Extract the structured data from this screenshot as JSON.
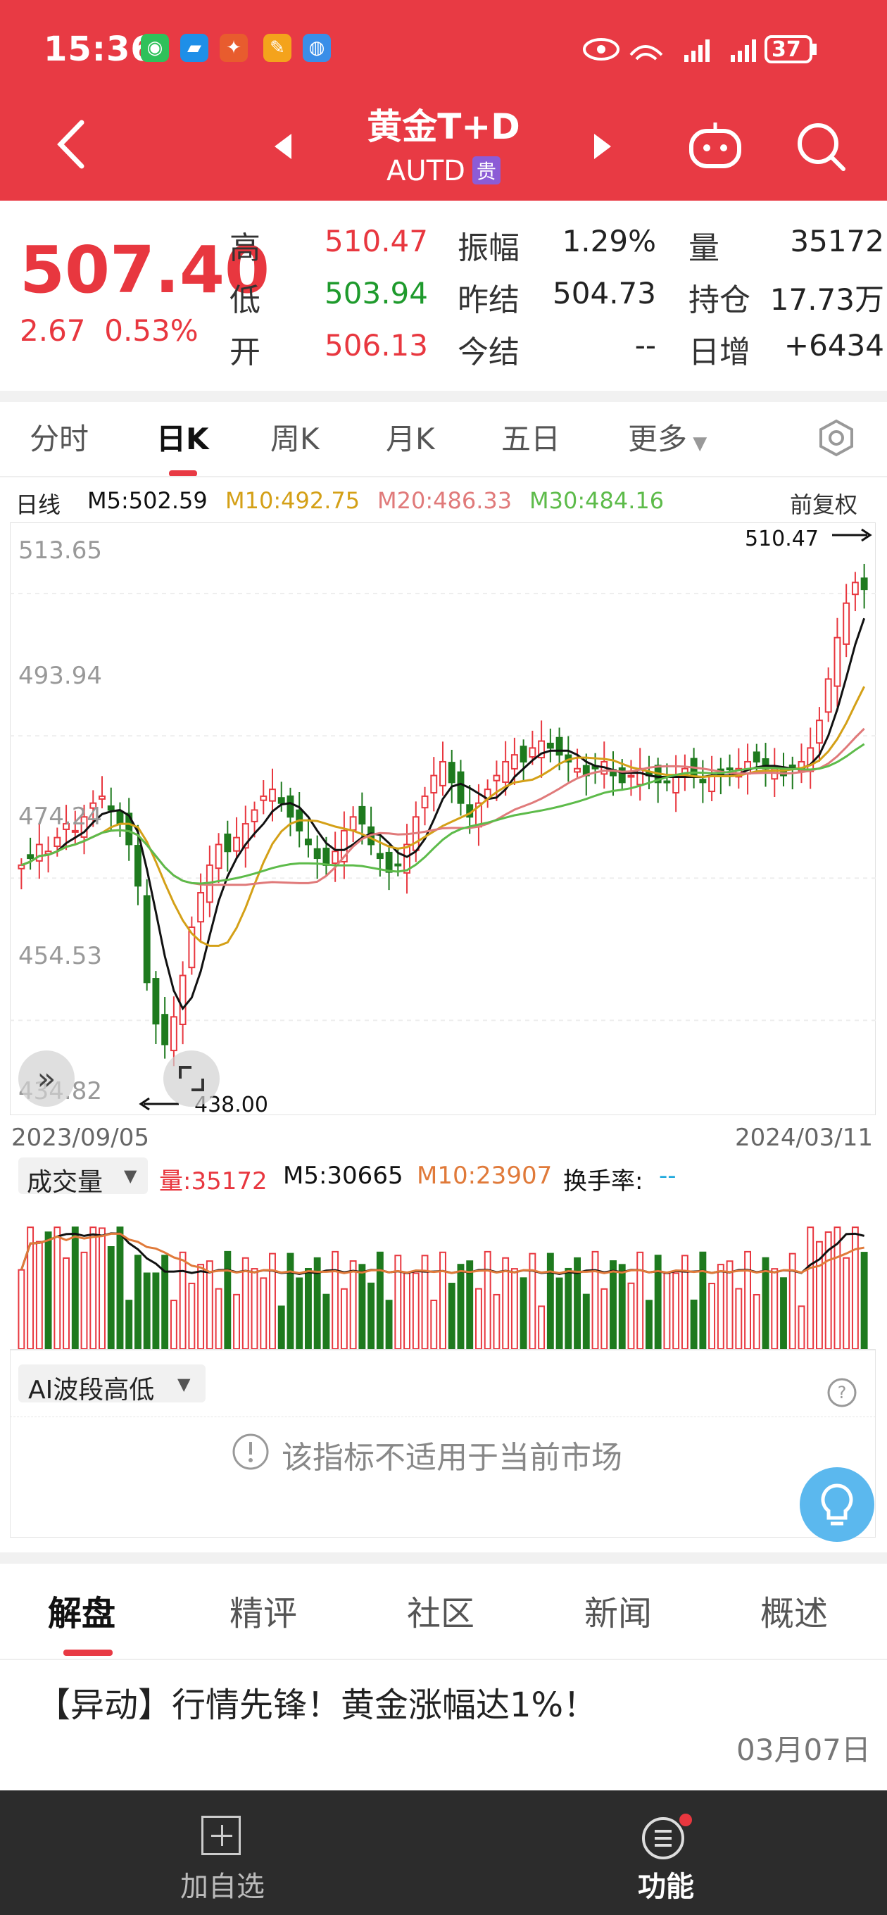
{
  "status": {
    "time": "15:36",
    "battery": "37"
  },
  "header": {
    "title": "黄金T+D",
    "code": "AUTD",
    "badge": "贵"
  },
  "quote": {
    "price": "507.40",
    "change": "2.67",
    "change_pct": "0.53%",
    "rows": [
      {
        "l1": "高",
        "v1": "510.47",
        "l2": "振幅",
        "v2": "1.29%",
        "l3": "量",
        "v3": "35172"
      },
      {
        "l1": "低",
        "v1": "503.94",
        "l2": "昨结",
        "v2": "504.73",
        "l3": "持仓",
        "v3": "17.73万"
      },
      {
        "l1": "开",
        "v1": "506.13",
        "l2": "今结",
        "v2": "--",
        "l3": "日增",
        "v3": "+6434"
      }
    ]
  },
  "tabs": [
    "分时",
    "日K",
    "周K",
    "月K",
    "五日",
    "更多"
  ],
  "ma_legend": {
    "label": "日线",
    "m5": "M5:502.59",
    "m10": "M10:492.75",
    "m20": "M20:486.33",
    "m30": "M30:484.16",
    "adjust": "前复权"
  },
  "chart_data": {
    "type": "candlestick",
    "x_start": "2023/09/05",
    "x_end": "2024/03/11",
    "y_ticks": [
      "513.65",
      "493.94",
      "474.24",
      "454.53",
      "434.82"
    ],
    "ylim": [
      434.82,
      513.65
    ],
    "high_marker": "510.47",
    "low_marker": "438.00",
    "series_colors": {
      "up": "#e8373f",
      "down": "#1e7a1e",
      "m5": "#111111",
      "m10": "#d4a017",
      "m20": "#e07a7a",
      "m30": "#5dbb4a"
    },
    "closes": [
      467,
      468,
      470,
      469,
      471,
      473,
      472,
      474,
      476,
      477,
      475,
      473,
      470,
      464,
      450,
      444,
      441,
      445,
      451,
      458,
      463,
      467,
      470,
      469,
      471,
      473,
      475,
      477,
      478,
      476,
      474,
      472,
      470,
      468,
      467,
      469,
      472,
      474,
      473,
      470,
      468,
      466,
      467,
      470,
      474,
      477,
      480,
      482,
      479,
      476,
      474,
      476,
      478,
      480,
      482,
      483,
      482,
      484,
      485,
      484,
      483,
      482,
      481,
      480,
      481,
      482,
      480,
      479,
      480,
      481,
      480,
      479,
      479,
      480,
      481,
      480,
      479,
      480,
      480,
      481,
      481,
      482,
      482,
      481,
      481,
      480,
      481,
      482,
      484,
      488,
      494,
      500,
      505,
      508,
      507
    ],
    "volume": {
      "label": "成交量",
      "vol": "量:35172",
      "m5": "M5:30665",
      "m10": "M10:23907",
      "turnover": "换手率:",
      "turnover_val": "--"
    }
  },
  "indicator": {
    "name": "AI波段高低",
    "message": "该指标不适用于当前市场"
  },
  "bottom_tabs": [
    "解盘",
    "精评",
    "社区",
    "新闻",
    "概述"
  ],
  "news": {
    "headline": "【异动】行情先锋！黄金涨幅达1%！",
    "date": "03月07日"
  },
  "footer": {
    "add": "加自选",
    "func": "功能"
  }
}
